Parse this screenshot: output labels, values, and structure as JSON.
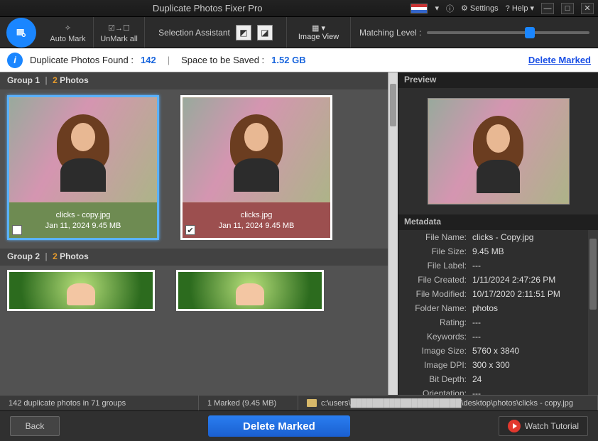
{
  "titlebar": {
    "title": "Duplicate Photos Fixer Pro",
    "info_label": "i",
    "settings_label": "Settings",
    "help_label": "? Help",
    "min": "—",
    "max": "□",
    "close": "✕"
  },
  "toolbar": {
    "auto_mark": "Auto Mark",
    "unmark_all": "UnMark all",
    "selection_assistant": "Selection Assistant",
    "image_view": "Image View",
    "matching_level": "Matching Level :"
  },
  "infobar": {
    "found_label": "Duplicate Photos Found :",
    "found_count": "142",
    "space_label": "Space to be Saved :",
    "space_value": "1.52 GB",
    "delete_marked": "Delete Marked"
  },
  "groups": [
    {
      "header_prefix": "Group 1",
      "count": "2",
      "count_suffix": "Photos",
      "cards": [
        {
          "name": "clicks - copy.jpg",
          "meta": "Jan 11, 2024    9.45 MB",
          "checked": false,
          "cap": "green",
          "selected": true
        },
        {
          "name": "clicks.jpg",
          "meta": "Jan 11, 2024    9.45 MB",
          "checked": true,
          "cap": "red",
          "selected": false
        }
      ]
    },
    {
      "header_prefix": "Group 2",
      "count": "2",
      "count_suffix": "Photos"
    }
  ],
  "right": {
    "preview_label": "Preview",
    "metadata_label": "Metadata",
    "meta": [
      {
        "k": "File Name:",
        "v": "clicks - Copy.jpg"
      },
      {
        "k": "File Size:",
        "v": "9.45 MB"
      },
      {
        "k": "File Label:",
        "v": "---"
      },
      {
        "k": "File Created:",
        "v": "1/11/2024 2:47:26 PM"
      },
      {
        "k": "File Modified:",
        "v": "10/17/2020 2:11:51 PM"
      },
      {
        "k": "Folder Name:",
        "v": "photos"
      },
      {
        "k": "Rating:",
        "v": "---"
      },
      {
        "k": "Keywords:",
        "v": "---"
      },
      {
        "k": "Image Size:",
        "v": "5760 x 3840"
      },
      {
        "k": "Image DPI:",
        "v": "300 x 300"
      },
      {
        "k": "Bit Depth:",
        "v": "24"
      },
      {
        "k": "Orientation:",
        "v": "---"
      }
    ]
  },
  "status": {
    "dup": "142 duplicate photos in 71 groups",
    "marked": "1 Marked (9.45 MB)",
    "path": "c:\\users\\████████████████████\\desktop\\photos\\clicks - copy.jpg"
  },
  "bottom": {
    "back": "Back",
    "delete": "Delete Marked",
    "watch": "Watch Tutorial"
  }
}
